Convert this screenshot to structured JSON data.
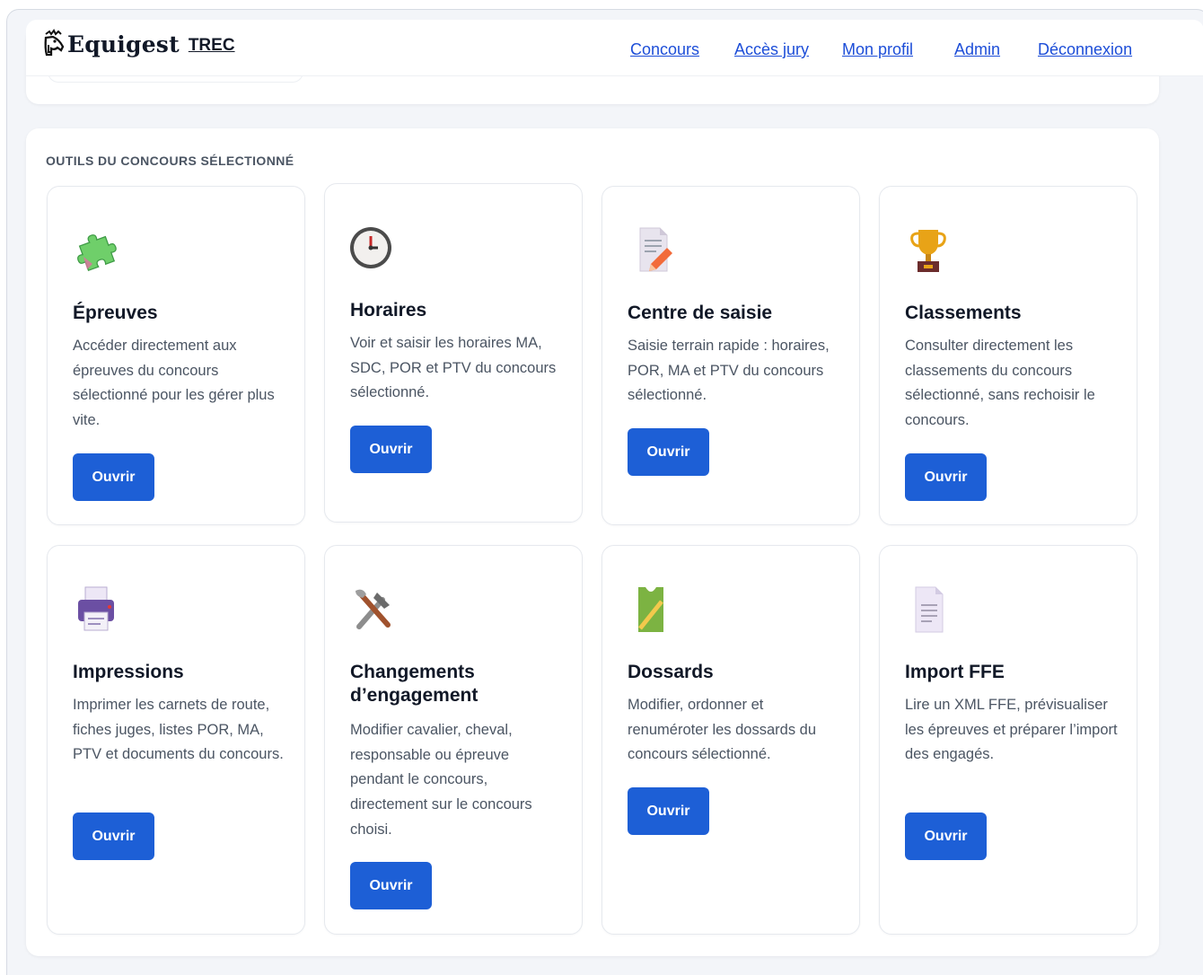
{
  "header": {
    "brand_name": "Equigest",
    "brand_sub": "TREC",
    "nav": [
      {
        "label": "Concours"
      },
      {
        "label": "Accès jury"
      },
      {
        "label": "Mon profil"
      },
      {
        "label": "Admin"
      },
      {
        "label": "Déconnexion"
      }
    ]
  },
  "section": {
    "title": "OUTILS DU CONCOURS SÉLECTIONNÉ"
  },
  "cards": [
    {
      "icon": "puzzle-icon",
      "title": "Épreuves",
      "desc": "Accéder directement aux épreuves du concours sélectionné pour les gérer plus vite.",
      "button": "Ouvrir"
    },
    {
      "icon": "clock-icon",
      "title": "Horaires",
      "desc": "Voir et saisir les horaires MA, SDC, POR et PTV du concours sélectionné.",
      "button": "Ouvrir"
    },
    {
      "icon": "memo-icon",
      "title": "Centre de saisie",
      "desc": "Saisie terrain rapide : horaires, POR, MA et PTV du concours sélectionné.",
      "button": "Ouvrir"
    },
    {
      "icon": "trophy-icon",
      "title": "Classements",
      "desc": "Consulter directement les classements du concours sélectionné, sans rechoisir le concours.",
      "button": "Ouvrir"
    },
    {
      "icon": "printer-icon",
      "title": "Impressions",
      "desc": "Imprimer les carnets de route, fiches juges, listes POR, MA, PTV et documents du concours.",
      "button": "Ouvrir"
    },
    {
      "icon": "tools-icon",
      "title": "Changements d’engagement",
      "desc": "Modifier cavalier, cheval, responsable ou épreuve pendant le concours, directement sur le concours choisi.",
      "button": "Ouvrir"
    },
    {
      "icon": "bib-icon",
      "title": "Dossards",
      "desc": "Modifier, ordonner et renuméroter les dossards du concours sélectionné.",
      "button": "Ouvrir"
    },
    {
      "icon": "document-icon",
      "title": "Import FFE",
      "desc": "Lire un XML FFE, prévisualiser les épreuves et préparer l’import des engagés.",
      "button": "Ouvrir"
    }
  ],
  "colors": {
    "accent": "#1d5fd6",
    "link": "#1d4ed8",
    "background": "#f3f5f9"
  }
}
